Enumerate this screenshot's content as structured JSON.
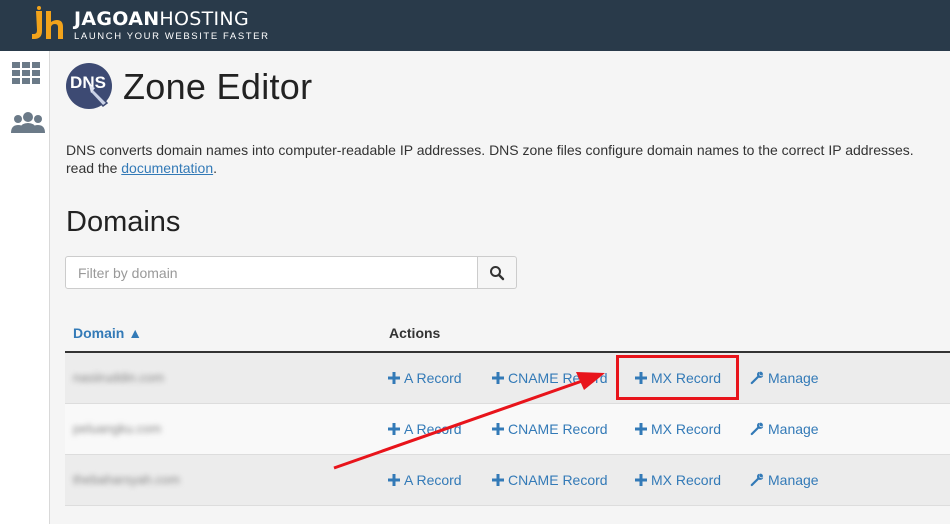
{
  "brand": {
    "name_bold": "JAGOAN",
    "name_rest": "HOSTING",
    "tagline": "LAUNCH YOUR WEBSITE FASTER",
    "accent": "#f2a31b"
  },
  "sidebar": {
    "items": [
      {
        "icon": "grid-icon"
      },
      {
        "icon": "users-icon"
      }
    ]
  },
  "page": {
    "title": "Zone Editor",
    "icon_text": "DNS",
    "description_part1": "DNS converts domain names into computer-readable IP addresses. DNS zone files configure domain names to the correct IP addresses.",
    "description_part2": "read the ",
    "description_link": "documentation",
    "description_end": "."
  },
  "domains": {
    "heading": "Domains",
    "search_placeholder": "Filter by domain",
    "columns": {
      "domain": "Domain ▲",
      "actions": "Actions"
    },
    "rows": [
      {
        "domain": "nasiiruddin.com"
      },
      {
        "domain": "peluangku.com"
      },
      {
        "domain": "thebaharsyah.com"
      }
    ],
    "actions": {
      "a_record": "A Record",
      "cname_record": "CNAME Record",
      "mx_record": "MX Record",
      "manage": "Manage"
    }
  },
  "colors": {
    "topbar": "#293a4a",
    "link": "#337ab7",
    "highlight": "#e8141b"
  }
}
